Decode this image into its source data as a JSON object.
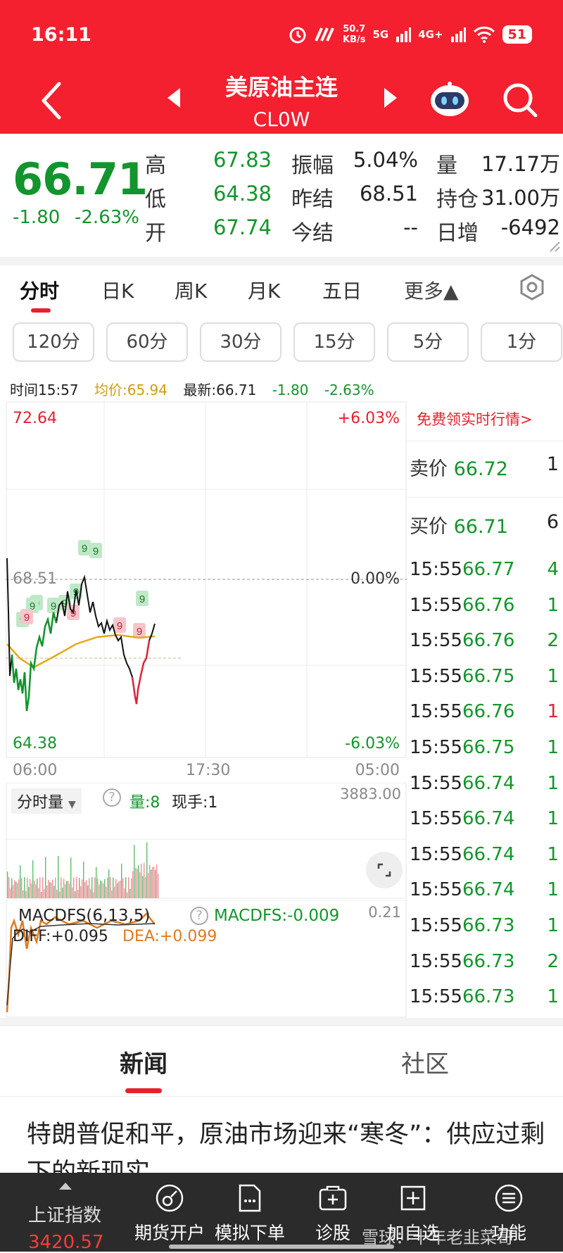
{
  "status_bar": {
    "time": "16:11",
    "net_speed": "50.7\nKB/s",
    "net1": "5G",
    "net2": "4G+",
    "battery": "51"
  },
  "header": {
    "title": "美原油主连",
    "code": "CL0W"
  },
  "quote": {
    "price": "66.71",
    "change": "-1.80",
    "change_pct": "-2.63%",
    "high_label": "高",
    "high": "67.83",
    "low_label": "低",
    "low": "64.38",
    "open_label": "开",
    "open": "67.74",
    "amp_label": "振幅",
    "amp": "5.04%",
    "prev_settle_label": "昨结",
    "prev_settle": "68.51",
    "settle_label": "今结",
    "settle": "--",
    "vol_label": "量",
    "vol": "17.17万",
    "oi_label": "持仓",
    "oi": "31.00万",
    "daily_inc_label": "日增",
    "daily_inc": "-6492"
  },
  "tabs": [
    "分时",
    "日K",
    "周K",
    "月K",
    "五日",
    "更多▲"
  ],
  "periods": [
    "120分",
    "60分",
    "30分",
    "15分",
    "5分",
    "1分"
  ],
  "infoline": {
    "time": "时间15:57",
    "avg": "均价:65.94",
    "latest": "最新:66.71",
    "chg": "-1.80",
    "pct": "-2.63%"
  },
  "chart": {
    "y_max": "72.64",
    "y_mid": "68.51",
    "y_min": "64.38",
    "pct_max": "+6.03%",
    "pct_mid": "0.00%",
    "pct_min": "-6.03%",
    "x_start": "06:00",
    "x_mid": "17:30",
    "x_end": "05:00",
    "marker": "9"
  },
  "volume": {
    "label": "分时量",
    "liang": "量:8",
    "xianshou": "现手:1",
    "max": "3883.00"
  },
  "macd": {
    "label": "MACDFS(6,13,5)",
    "value": "MACDFS:-0.009",
    "diff": "DIFF:+0.095",
    "dea": "DEA:+0.099",
    "max": "0.21"
  },
  "book": {
    "promo": "免费领实时行情>",
    "ask_label": "卖价",
    "ask": "66.72",
    "ask_qty": "1",
    "bid_label": "买价",
    "bid": "66.71",
    "bid_qty": "6"
  },
  "ticks": [
    {
      "t": "15:55",
      "p": "66.77",
      "q": "4"
    },
    {
      "t": "15:55",
      "p": "66.76",
      "q": "1"
    },
    {
      "t": "15:55",
      "p": "66.76",
      "q": "2"
    },
    {
      "t": "15:55",
      "p": "66.75",
      "q": "1"
    },
    {
      "t": "15:55",
      "p": "66.76",
      "q": "1"
    },
    {
      "t": "15:55",
      "p": "66.75",
      "q": "1"
    },
    {
      "t": "15:55",
      "p": "66.74",
      "q": "1"
    },
    {
      "t": "15:55",
      "p": "66.74",
      "q": "1"
    },
    {
      "t": "15:55",
      "p": "66.74",
      "q": "1"
    },
    {
      "t": "15:55",
      "p": "66.74",
      "q": "1"
    },
    {
      "t": "15:55",
      "p": "66.73",
      "q": "1"
    },
    {
      "t": "15:55",
      "p": "66.73",
      "q": "2"
    },
    {
      "t": "15:55",
      "p": "66.73",
      "q": "1"
    }
  ],
  "news": {
    "tab_news": "新闻",
    "tab_community": "社区",
    "headline": "特朗普促和平，原油市场迎来“寒冬”：供应过剩下的新现实"
  },
  "bottom": {
    "index_label": "上证指数",
    "index_value": "3420.57",
    "items": [
      "期货开户",
      "模拟下单",
      "诊股",
      "加自选",
      "功能"
    ],
    "watermark": "雪球：十年老韭菜哥"
  },
  "colors": {
    "brand_red": "#f41f2f",
    "down_green": "#12952c",
    "up_red": "#e8202e",
    "avg_line": "#e6a817"
  }
}
